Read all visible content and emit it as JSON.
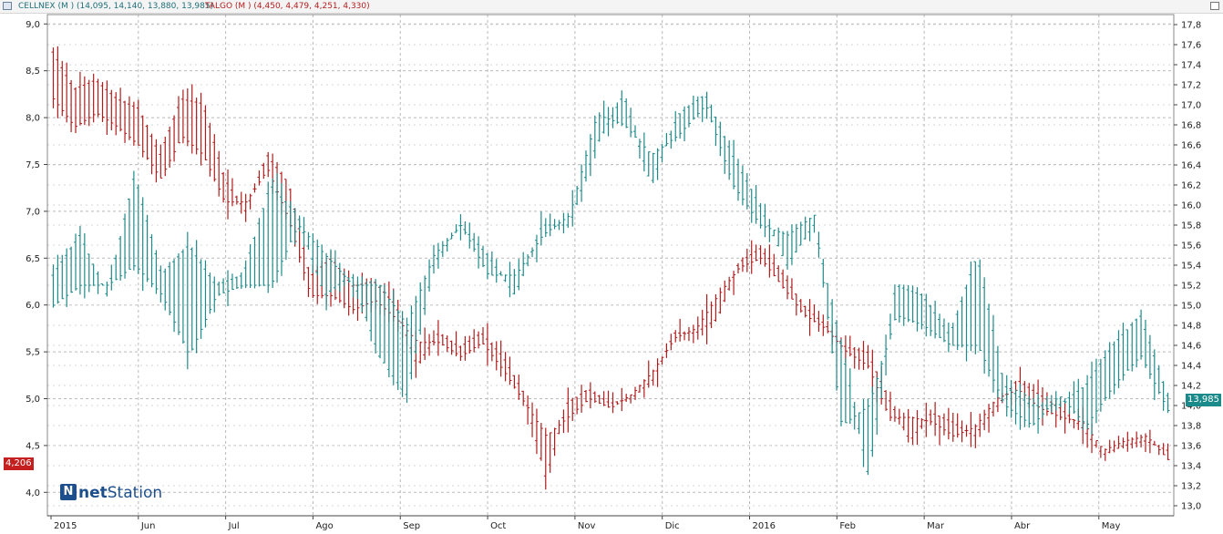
{
  "header": {
    "series1": "CELLNEX (M ) (14,095, 14,140, 13,880, 13,985)",
    "series2": "TALGO (M ) (4,450, 4,479, 4,251, 4,330)"
  },
  "logo": {
    "prefix": "net",
    "suffix": "Station"
  },
  "badges": {
    "left": "4,206",
    "right": "13,985"
  },
  "colors": {
    "cellnex": "#1f8a8a",
    "talgo": "#b01c1c",
    "grid": "#b9b9b9"
  },
  "chart_data": {
    "type": "bar",
    "style": "ohlc-bars",
    "grid": true,
    "x_labels": [
      "2015",
      "Jun",
      "Jul",
      "Ago",
      "Sep",
      "Oct",
      "Nov",
      "Dic",
      "2016",
      "Feb",
      "Mar",
      "Abr",
      "May"
    ],
    "left_axis": {
      "ticks": [
        "4,0",
        "4,5",
        "5,0",
        "5,5",
        "6,0",
        "6,5",
        "7,0",
        "7,5",
        "8,0",
        "8,5",
        "9,0"
      ],
      "range": [
        3.75,
        9.1
      ]
    },
    "right_axis": {
      "ticks": [
        "13,0",
        "13,2",
        "13,4",
        "13,6",
        "13,8",
        "14,0",
        "14,2",
        "14,4",
        "14,6",
        "14,8",
        "15,0",
        "15,2",
        "15,4",
        "15,6",
        "15,8",
        "16,0",
        "16,2",
        "16,4",
        "16,6",
        "16,8",
        "17,0",
        "17,2",
        "17,4",
        "17,6",
        "17,8"
      ],
      "range": [
        12.9,
        17.9
      ]
    },
    "series": [
      {
        "name": "TALGO",
        "axis": "left",
        "anchors": [
          [
            8.7,
            8.2
          ],
          [
            8.3,
            7.9
          ],
          [
            8.4,
            8.05
          ],
          [
            8.2,
            7.9
          ],
          [
            8.1,
            7.7
          ],
          [
            7.6,
            7.35
          ],
          [
            8.2,
            7.8
          ],
          [
            8.15,
            7.6
          ],
          [
            7.35,
            7.1
          ],
          [
            7.0,
            7.1
          ],
          [
            7.6,
            7.45
          ],
          [
            7.3,
            6.9
          ],
          [
            6.3,
            6.1
          ],
          [
            6.5,
            6.1
          ],
          [
            6.2,
            5.95
          ],
          [
            6.25,
            6.05
          ],
          [
            6.0,
            5.85
          ],
          [
            5.35,
            5.6
          ],
          [
            5.7,
            5.6
          ],
          [
            5.55,
            5.45
          ],
          [
            5.7,
            5.6
          ],
          [
            5.45,
            5.3
          ],
          [
            5.05,
            4.95
          ],
          [
            4.15,
            4.6
          ],
          [
            4.95,
            4.8
          ],
          [
            5.1,
            5.0
          ],
          [
            4.95,
            4.9
          ],
          [
            5.0,
            5.05
          ],
          [
            5.2,
            5.3
          ],
          [
            5.7,
            5.65
          ],
          [
            5.7,
            5.75
          ],
          [
            5.85,
            6.1
          ],
          [
            6.45,
            6.4
          ],
          [
            6.6,
            6.5
          ],
          [
            6.35,
            6.2
          ],
          [
            6.0,
            5.9
          ],
          [
            5.8,
            5.75
          ],
          [
            5.55,
            5.5
          ],
          [
            5.5,
            5.35
          ],
          [
            5.0,
            4.8
          ],
          [
            4.55,
            4.8
          ],
          [
            4.85,
            4.75
          ],
          [
            4.75,
            4.6
          ],
          [
            4.6,
            4.7
          ],
          [
            4.9,
            5.0
          ],
          [
            5.2,
            5.1
          ],
          [
            5.05,
            4.9
          ],
          [
            4.9,
            4.8
          ],
          [
            4.7,
            4.75
          ],
          [
            4.4,
            4.45
          ],
          [
            4.5,
            4.55
          ],
          [
            4.55,
            4.6
          ],
          [
            4.45,
            4.35
          ]
        ]
      },
      {
        "name": "CELLNEX",
        "axis": "right",
        "anchors": [
          [
            15.3,
            15.0
          ],
          [
            15.7,
            15.2
          ],
          [
            15.1,
            15.2
          ],
          [
            16.3,
            15.4
          ],
          [
            15.3,
            15.1
          ],
          [
            15.6,
            14.5
          ],
          [
            15.2,
            15.1
          ],
          [
            15.3,
            15.2
          ],
          [
            16.2,
            15.2
          ],
          [
            15.9,
            15.8
          ],
          [
            15.1,
            15.5
          ],
          [
            15.3,
            15.2
          ],
          [
            14.5,
            15.2
          ],
          [
            14.1,
            14.8
          ],
          [
            15.4,
            15.5
          ],
          [
            15.8,
            15.8
          ],
          [
            15.5,
            15.3
          ],
          [
            15.1,
            15.3
          ],
          [
            15.8,
            15.7
          ],
          [
            15.8,
            15.9
          ],
          [
            16.6,
            16.9
          ],
          [
            17.1,
            16.8
          ],
          [
            16.2,
            16.5
          ],
          [
            16.9,
            16.7
          ],
          [
            17.1,
            17.0
          ],
          [
            16.5,
            16.2
          ],
          [
            16.0,
            15.8
          ],
          [
            15.4,
            15.7
          ],
          [
            15.8,
            15.9
          ],
          [
            14.6,
            13.8
          ],
          [
            13.3,
            14.0
          ],
          [
            15.2,
            14.9
          ],
          [
            15.1,
            14.8
          ],
          [
            14.7,
            14.6
          ],
          [
            15.5,
            14.6
          ],
          [
            14.2,
            14.0
          ],
          [
            14.0,
            13.8
          ],
          [
            14.0,
            14.1
          ],
          [
            14.2,
            13.8
          ],
          [
            14.6,
            14.2
          ],
          [
            14.9,
            14.5
          ],
          [
            14.1,
            13.95
          ]
        ]
      }
    ]
  }
}
